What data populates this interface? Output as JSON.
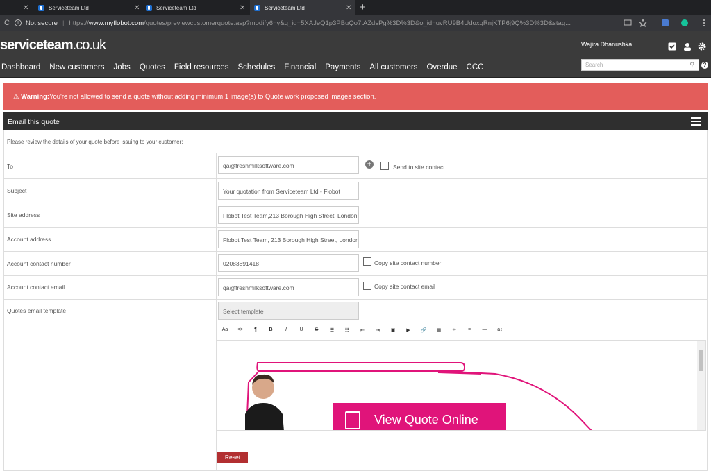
{
  "browser": {
    "tabs": [
      {
        "title": "Serviceteam Ltd"
      },
      {
        "title": "Serviceteam Ltd"
      },
      {
        "title": "Serviceteam Ltd"
      }
    ],
    "security": "Not secure",
    "url_prefix": "https://",
    "url_host": "www.myflobot.com",
    "url_path": "/quotes/previewcustomerquote.asp?modify6=y&q_id=5XAJeQ1p3PBuQo7tAZdsPg%3D%3D&o_id=uvRU9B4UdoxqRnjKTP6j9Q%3D%3D&stag..."
  },
  "app": {
    "logo_bold": "serviceteam",
    "logo_light": ".co.uk",
    "user_name": "Wajira Dhanushka",
    "menu": [
      "Dashboard",
      "New customers",
      "Jobs",
      "Quotes",
      "Field resources",
      "Schedules",
      "Financial",
      "Payments",
      "All customers",
      "Overdue",
      "CCC"
    ],
    "search_placeholder": "Search"
  },
  "warning": {
    "label": "Warning:",
    "text": "You're not allowed to send a quote without adding minimum 1 image(s) to Quote work proposed images section."
  },
  "panel": {
    "title": "Email this quote",
    "intro": "Please review the details of your quote before issuing to your customer:",
    "rows": {
      "to": {
        "label": "To",
        "value": "qa@freshmilksoftware.com",
        "checkbox_label": "Send to site contact"
      },
      "subject": {
        "label": "Subject",
        "value": "Your quotation from Serviceteam Ltd - Flobot"
      },
      "site_address": {
        "label": "Site address",
        "value": "Flobot Test Team,213 Borough High Street,  London"
      },
      "account_address": {
        "label": "Account address",
        "value": "Flobot Test Team, 213 Borough High Street, London"
      },
      "contact_number": {
        "label": "Account contact number",
        "value": "02083891418",
        "checkbox_label": "Copy site contact number"
      },
      "contact_email": {
        "label": "Account contact email",
        "value": "qa@freshmilksoftware.com",
        "checkbox_label": "Copy site contact email"
      },
      "template": {
        "label": "Quotes email template",
        "value": "Select template"
      }
    },
    "editor": {
      "toolbar": [
        "Aa",
        "<>",
        "¶",
        "B",
        "I",
        "U",
        "S",
        "☰",
        "☷",
        "⇤",
        "⇥",
        "▣",
        "▶",
        "🔗",
        "▦",
        "∞",
        "≡",
        "—",
        "a↕"
      ],
      "banner_text": "View Quote Online"
    },
    "reset_label": "Reset"
  }
}
